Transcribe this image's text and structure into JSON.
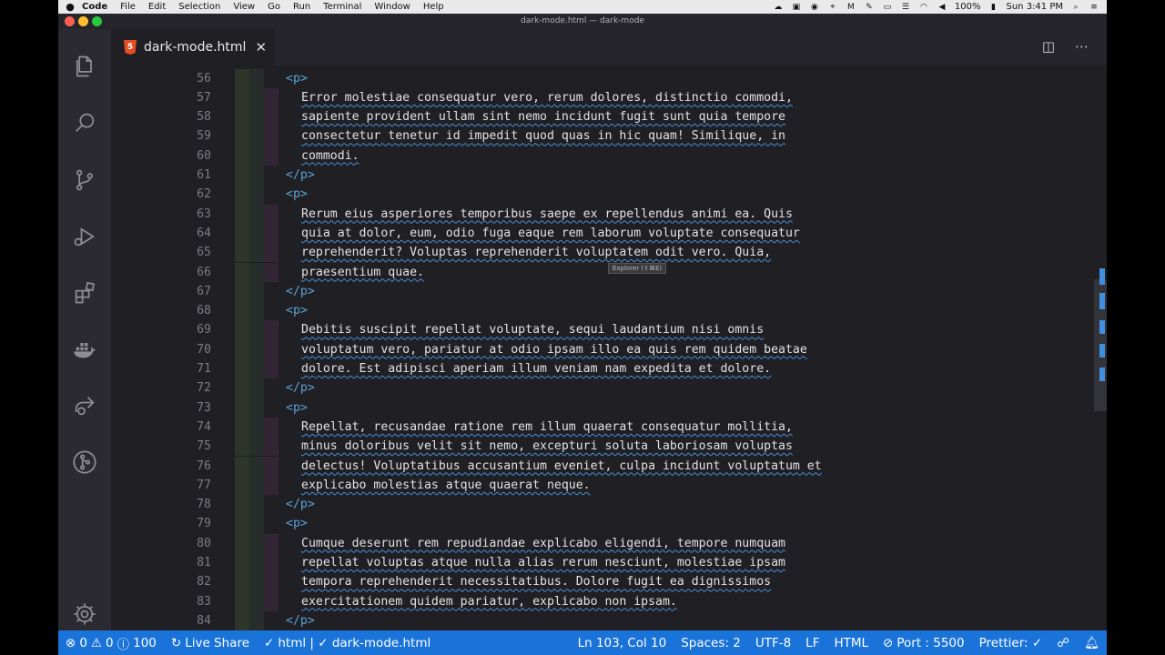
{
  "menubar": {
    "app": "Code",
    "items": [
      "File",
      "Edit",
      "Selection",
      "View",
      "Go",
      "Run",
      "Terminal",
      "Window",
      "Help"
    ],
    "battery": "100%",
    "clock": "Sun 3:41 PM"
  },
  "window": {
    "title": "dark-mode.html — dark-mode"
  },
  "tab": {
    "label": "dark-mode.html",
    "icon": "5"
  },
  "tooltip": "Explorer (⇧⌘E)",
  "editor": {
    "lines": [
      {
        "n": "56",
        "kind": "open",
        "text": "<p>"
      },
      {
        "n": "57",
        "kind": "text",
        "text": "Error molestiae consequatur vero, rerum dolores, distinctio commodi,"
      },
      {
        "n": "58",
        "kind": "text",
        "text": "sapiente provident ullam sint nemo incidunt fugit sunt quia tempore"
      },
      {
        "n": "59",
        "kind": "text",
        "text": "consectetur tenetur id impedit quod quas in hic quam! Similique, in"
      },
      {
        "n": "60",
        "kind": "text",
        "text": "commodi."
      },
      {
        "n": "61",
        "kind": "close",
        "text": "</p>"
      },
      {
        "n": "62",
        "kind": "open",
        "text": "<p>"
      },
      {
        "n": "63",
        "kind": "text",
        "text": "Rerum eius asperiores temporibus saepe ex repellendus animi ea. Quis"
      },
      {
        "n": "64",
        "kind": "text",
        "text": "quia at dolor, eum, odio fuga eaque rem laborum voluptate consequatur"
      },
      {
        "n": "65",
        "kind": "text",
        "text": "reprehenderit? Voluptas reprehenderit voluptatem odit vero. Quia,"
      },
      {
        "n": "66",
        "kind": "text",
        "text": "praesentium quae."
      },
      {
        "n": "67",
        "kind": "close",
        "text": "</p>"
      },
      {
        "n": "68",
        "kind": "open",
        "text": "<p>"
      },
      {
        "n": "69",
        "kind": "text",
        "text": "Debitis suscipit repellat voluptate, sequi laudantium nisi omnis"
      },
      {
        "n": "70",
        "kind": "text",
        "text": "voluptatum vero, pariatur at odio ipsam illo ea quis rem quidem beatae"
      },
      {
        "n": "71",
        "kind": "text",
        "text": "dolore. Est adipisci aperiam illum veniam nam expedita et dolore."
      },
      {
        "n": "72",
        "kind": "close",
        "text": "</p>"
      },
      {
        "n": "73",
        "kind": "open",
        "text": "<p>"
      },
      {
        "n": "74",
        "kind": "text",
        "text": "Repellat, recusandae ratione rem illum quaerat consequatur mollitia,"
      },
      {
        "n": "75",
        "kind": "text",
        "text": "minus doloribus velit sit nemo, excepturi soluta laboriosam voluptas"
      },
      {
        "n": "76",
        "kind": "text",
        "text": "delectus! Voluptatibus accusantium eveniet, culpa incidunt voluptatum et"
      },
      {
        "n": "77",
        "kind": "text",
        "text": "explicabo molestias atque quaerat neque."
      },
      {
        "n": "78",
        "kind": "close",
        "text": "</p>"
      },
      {
        "n": "79",
        "kind": "open",
        "text": "<p>"
      },
      {
        "n": "80",
        "kind": "text",
        "text": "Cumque deserunt rem repudiandae explicabo eligendi, tempore numquam"
      },
      {
        "n": "81",
        "kind": "text",
        "text": "repellat voluptas atque nulla alias rerum nesciunt, molestiae ipsam"
      },
      {
        "n": "82",
        "kind": "text",
        "text": "tempora reprehenderit necessitatibus. Dolore fugit ea dignissimos"
      },
      {
        "n": "83",
        "kind": "text",
        "text": "exercitationem quidem pariatur, explicabo non ipsam."
      },
      {
        "n": "84",
        "kind": "close",
        "text": "</p>"
      }
    ]
  },
  "statusbar": {
    "errors": "0",
    "warnings": "0",
    "info": "100",
    "live_share": "Live Share",
    "language_check": "html | ✓ dark-mode.html",
    "cursor": "Ln 103, Col 10",
    "spaces": "Spaces: 2",
    "encoding": "UTF-8",
    "eol": "LF",
    "language": "HTML",
    "port": "Port : 5500",
    "prettier": "Prettier: ✓"
  },
  "colors": {
    "accent": "#1a73d9",
    "tag": "#5aa4d8",
    "spell_squiggle": "#4a8fd6"
  }
}
